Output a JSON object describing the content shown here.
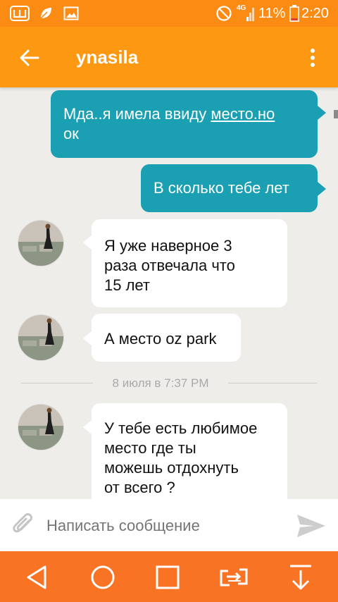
{
  "status_bar": {
    "battery_percent": "11%",
    "time": "2:20",
    "network": "4G",
    "left_icons": [
      "app-w-icon",
      "leaf-icon",
      "image-icon"
    ]
  },
  "header": {
    "back_icon": "arrow-left-icon",
    "title": "ynasila",
    "menu_icon": "more-vertical-icon"
  },
  "messages": [
    {
      "direction": "outgoing",
      "line1_prefix": "Мда..я имела ввиду ",
      "link_text": "место.но",
      "line2": "ок"
    },
    {
      "direction": "outgoing",
      "text": "В сколько тебе лет"
    },
    {
      "direction": "incoming",
      "lines": [
        "Я уже наверное 3",
        "раза отвечала что",
        "15 лет"
      ]
    },
    {
      "direction": "incoming",
      "text": "А место oz park"
    },
    {
      "direction": "incoming",
      "lines": [
        "У тебе есть любимое",
        "место где ты",
        "можешь отдохнуть",
        "от всего ?"
      ]
    }
  ],
  "date_divider": "8 июля в 7:37 PM",
  "composer": {
    "attach_icon": "paperclip-icon",
    "placeholder": "Написать сообщение",
    "send_icon": "send-icon"
  },
  "nav_bar": {
    "buttons": [
      "back-triangle-icon",
      "home-circle-icon",
      "recents-square-icon",
      "switch-app-icon",
      "download-arrow-icon"
    ]
  },
  "colors": {
    "status_bar": "#fc8b14",
    "app_bar": "#fd9812",
    "outgoing_bubble": "#1aa0b2",
    "incoming_bubble": "#ffffff",
    "chat_background": "#efedea",
    "nav_bar": "#f97324"
  }
}
